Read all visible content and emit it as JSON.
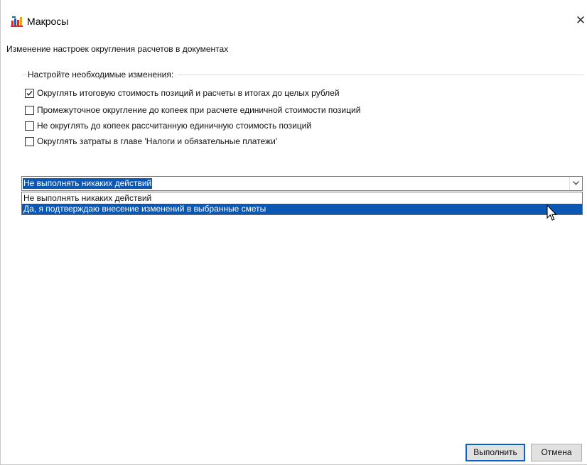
{
  "window": {
    "title": "Макросы",
    "icon": "macros-app-icon",
    "close": "✕"
  },
  "subtitle": "Изменение настроек округления расчетов в документах",
  "group": {
    "label": "Настройте необходимые изменения:"
  },
  "options": [
    {
      "label": "Округлять итоговую стоимость позиций и расчеты в итогах до целых рублей",
      "checked": true
    },
    {
      "label": "Промежуточное округление до копеек при расчете единичной стоимости позиций",
      "checked": false
    },
    {
      "label": "Не округлять до копеек рассчитанную единичную стоимость позиций",
      "checked": false
    },
    {
      "label": "Округлять затраты в главе 'Налоги и обязательные платежи'",
      "checked": false
    }
  ],
  "combo": {
    "value": "Не выполнять никаких действий",
    "options": [
      "Не выполнять никаких действий",
      "Да, я подтверждаю внесение изменений в выбранные сметы"
    ],
    "highlighted_option": "Да, я подтверждаю внесение изменений в выбранные сметы"
  },
  "buttons": {
    "run": "Выполнить",
    "cancel": "Отмена"
  },
  "colors": {
    "selection": "#0a58b4",
    "primary_border": "#0a64c8",
    "button_bg": "#e1e1e1"
  }
}
